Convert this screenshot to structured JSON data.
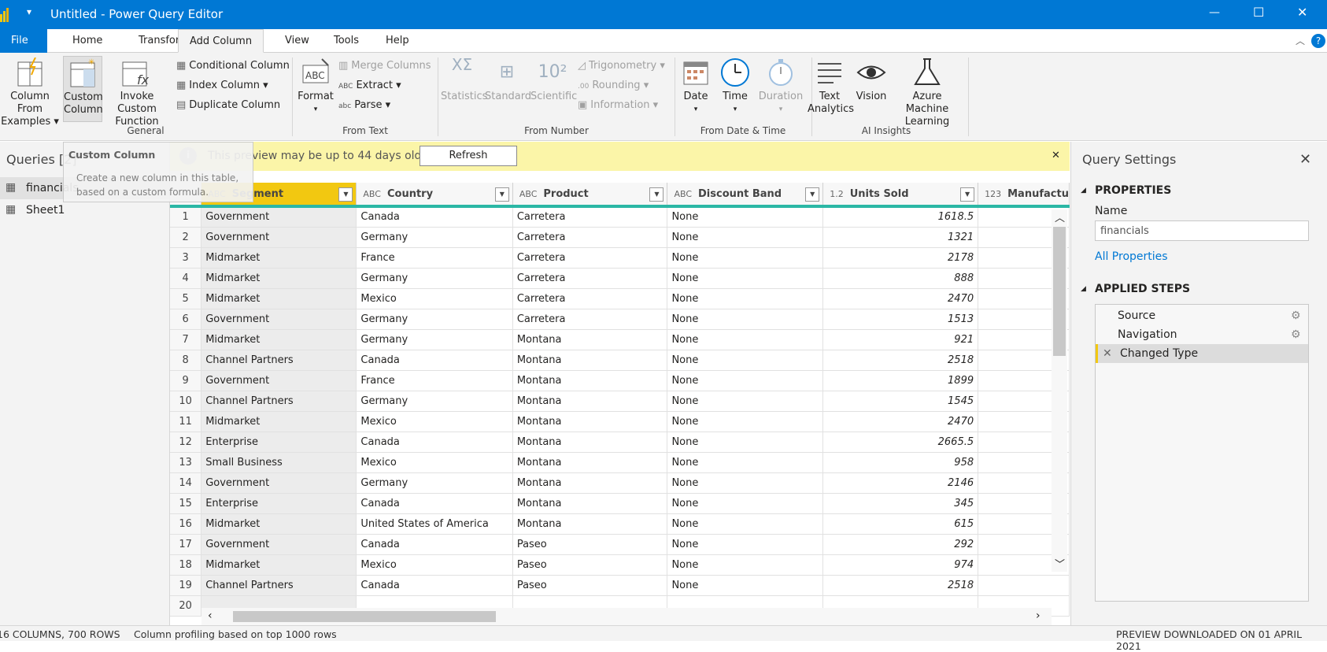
{
  "titlebar": {
    "title": "Untitled - Power Query Editor",
    "min": "—",
    "max": "☐",
    "close": "✕"
  },
  "tabs": [
    "File",
    "Home",
    "Transform",
    "Add Column",
    "View",
    "Tools",
    "Help"
  ],
  "active_tab": "Add Column",
  "ribbon": {
    "col_examples": [
      "Column From",
      "Examples ▾"
    ],
    "custom_column": [
      "Custom",
      "Column"
    ],
    "invoke_custom": [
      "Invoke Custom",
      "Function"
    ],
    "conditional": "Conditional Column",
    "index": "Index Column ▾",
    "duplicate": "Duplicate Column",
    "group_general": "General",
    "format": "Format",
    "merge": "Merge Columns",
    "extract": "Extract ▾",
    "parse": "Parse ▾",
    "group_text": "From Text",
    "statistics": "Statistics",
    "standard": "Standard",
    "scientific": "Scientific",
    "trig": "Trigonometry ▾",
    "rounding": "Rounding ▾",
    "information": "Information ▾",
    "group_number": "From Number",
    "date": "Date",
    "time": "Time",
    "duration": "Duration",
    "group_datetime": "From Date & Time",
    "text_analytics": [
      "Text",
      "Analytics"
    ],
    "vision": "Vision",
    "azure_ml": [
      "Azure Machine",
      "Learning"
    ],
    "group_ai": "AI Insights"
  },
  "queries": {
    "header": "Queries [2]",
    "items": [
      "financials",
      "Sheet1"
    ]
  },
  "tooltip": {
    "title": "Custom Column",
    "body1": "Create a new column in this table,",
    "body2": "based on a custom formula."
  },
  "message": {
    "text": "This preview may be up to 44 days old.",
    "button": "Refresh"
  },
  "grid": {
    "columns": [
      {
        "type": "ABC",
        "name": "Segment"
      },
      {
        "type": "ABC",
        "name": "Country"
      },
      {
        "type": "ABC",
        "name": "Product"
      },
      {
        "type": "ABC",
        "name": "Discount Band"
      },
      {
        "type": "1.2",
        "name": "Units Sold"
      },
      {
        "type": "123",
        "name": "Manufactu"
      }
    ],
    "rows": [
      [
        "1",
        "Government",
        "Canada",
        "Carretera",
        "None",
        "1618.5"
      ],
      [
        "2",
        "Government",
        "Germany",
        "Carretera",
        "None",
        "1321"
      ],
      [
        "3",
        "Midmarket",
        "France",
        "Carretera",
        "None",
        "2178"
      ],
      [
        "4",
        "Midmarket",
        "Germany",
        "Carretera",
        "None",
        "888"
      ],
      [
        "5",
        "Midmarket",
        "Mexico",
        "Carretera",
        "None",
        "2470"
      ],
      [
        "6",
        "Government",
        "Germany",
        "Carretera",
        "None",
        "1513"
      ],
      [
        "7",
        "Midmarket",
        "Germany",
        "Montana",
        "None",
        "921"
      ],
      [
        "8",
        "Channel Partners",
        "Canada",
        "Montana",
        "None",
        "2518"
      ],
      [
        "9",
        "Government",
        "France",
        "Montana",
        "None",
        "1899"
      ],
      [
        "10",
        "Channel Partners",
        "Germany",
        "Montana",
        "None",
        "1545"
      ],
      [
        "11",
        "Midmarket",
        "Mexico",
        "Montana",
        "None",
        "2470"
      ],
      [
        "12",
        "Enterprise",
        "Canada",
        "Montana",
        "None",
        "2665.5"
      ],
      [
        "13",
        "Small Business",
        "Mexico",
        "Montana",
        "None",
        "958"
      ],
      [
        "14",
        "Government",
        "Germany",
        "Montana",
        "None",
        "2146"
      ],
      [
        "15",
        "Enterprise",
        "Canada",
        "Montana",
        "None",
        "345"
      ],
      [
        "16",
        "Midmarket",
        "United States of America",
        "Montana",
        "None",
        "615"
      ],
      [
        "17",
        "Government",
        "Canada",
        "Paseo",
        "None",
        "292"
      ],
      [
        "18",
        "Midmarket",
        "Mexico",
        "Paseo",
        "None",
        "974"
      ],
      [
        "19",
        "Channel Partners",
        "Canada",
        "Paseo",
        "None",
        "2518"
      ],
      [
        "20",
        "",
        "",
        "",
        "",
        ""
      ]
    ]
  },
  "settings": {
    "header": "Query Settings",
    "properties": "PROPERTIES",
    "name_label": "Name",
    "name_value": "financials",
    "all_properties": "All Properties",
    "applied_steps": "APPLIED STEPS",
    "steps": [
      "Source",
      "Navigation",
      "Changed Type"
    ]
  },
  "status": {
    "left": "16 COLUMNS, 700 ROWS",
    "mid": "Column profiling based on top 1000 rows",
    "right": "PREVIEW DOWNLOADED ON 01 APRIL 2021"
  },
  "colors": {
    "accent": "#0078d4",
    "selected_col": "#f2c811",
    "header_bar": "#2bb7a5",
    "message_bg": "#fbf5a8"
  }
}
